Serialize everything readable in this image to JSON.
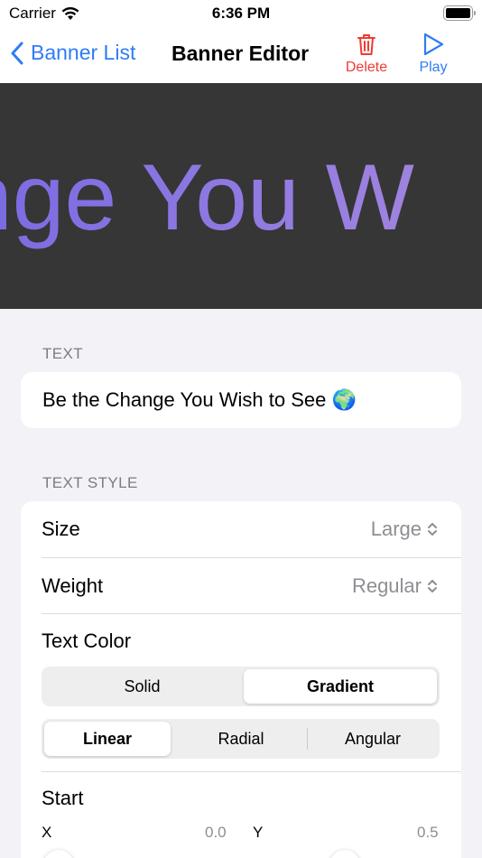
{
  "status_bar": {
    "carrier": "Carrier",
    "time": "6:36 PM"
  },
  "nav": {
    "back_label": "Banner List",
    "title": "Banner Editor",
    "delete_label": "Delete",
    "play_label": "Play"
  },
  "preview": {
    "text_visible": "ange You W"
  },
  "text_section": {
    "header": "TEXT",
    "value": "Be the Change You Wish to See 🌍"
  },
  "style_section": {
    "header": "TEXT STYLE",
    "size": {
      "label": "Size",
      "value": "Large"
    },
    "weight": {
      "label": "Weight",
      "value": "Regular"
    },
    "text_color": {
      "label": "Text Color",
      "fill_options": [
        "Solid",
        "Gradient"
      ],
      "selected_fill": "Gradient",
      "gradient_options": [
        "Linear",
        "Radial",
        "Angular"
      ],
      "selected_gradient": "Linear"
    },
    "start": {
      "label": "Start",
      "x_label": "X",
      "x_value": "0.0",
      "y_label": "Y",
      "y_value": "0.5"
    }
  },
  "colors": {
    "accent": "#2f7cf6",
    "destructive": "#ee3b32",
    "preview_bg": "#363636",
    "gradient_start": "#7467e3",
    "gradient_end": "#9f83df"
  }
}
